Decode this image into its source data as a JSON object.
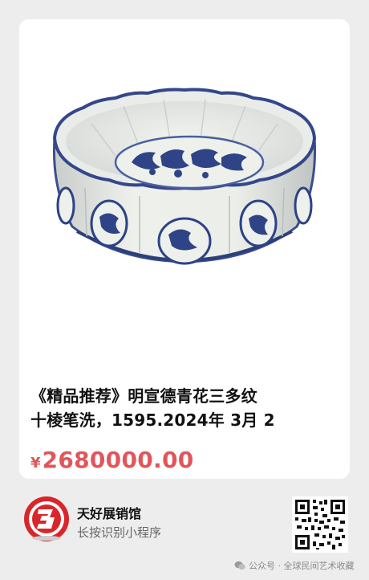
{
  "product": {
    "image_name": "blue-and-white-porcelain-brush-washer",
    "title_line1": "《精品推荐》明宣德青花三多纹",
    "title_line2": "十棱笔洗，1595.2024年 3月 2",
    "currency_symbol": "¥",
    "price": "2680000.00",
    "price_color": "#e0565b"
  },
  "mini_program": {
    "name": "天好展销馆",
    "hint": "长按识别小程序",
    "logo_icon": "red-3-logo-icon",
    "qr_icon": "qr-code-icon"
  },
  "watermark": {
    "text": "公众号 · 全球民间艺术收藏",
    "icon": "wechat-icon"
  }
}
